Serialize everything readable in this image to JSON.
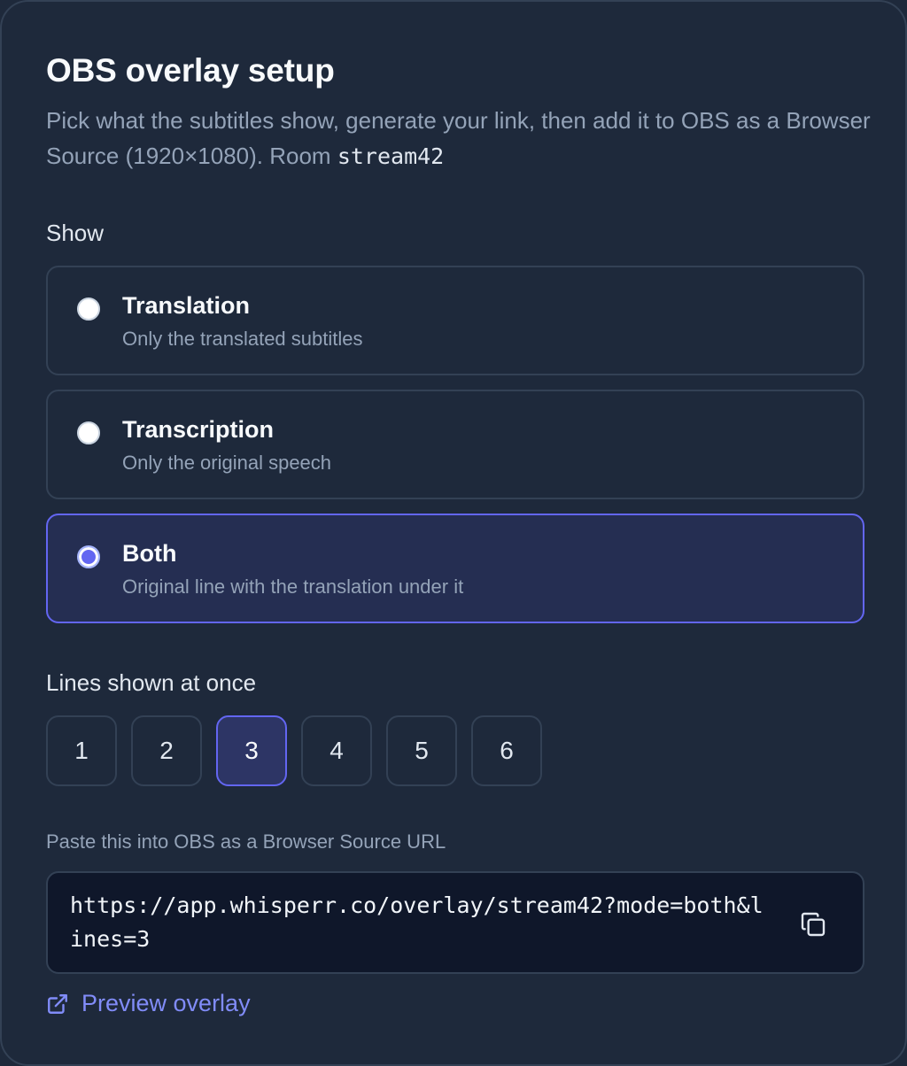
{
  "header": {
    "title": "OBS overlay setup",
    "description_prefix": "Pick what the subtitles show, generate your link, then add it to OBS as a Browser Source (1920×1080). Room ",
    "room_code": "stream42"
  },
  "show": {
    "label": "Show",
    "options": [
      {
        "title": "Translation",
        "subtitle": "Only the translated subtitles",
        "selected": false
      },
      {
        "title": "Transcription",
        "subtitle": "Only the original speech",
        "selected": false
      },
      {
        "title": "Both",
        "subtitle": "Original line with the translation under it",
        "selected": true
      }
    ]
  },
  "lines": {
    "label": "Lines shown at once",
    "options": [
      "1",
      "2",
      "3",
      "4",
      "5",
      "6"
    ],
    "selected": "3"
  },
  "url": {
    "label": "Paste this into OBS as a Browser Source URL",
    "value": "https://app.whisperr.co/overlay/stream42?mode=both&lines=3",
    "copy_icon": "copy-icon"
  },
  "preview": {
    "label": "Preview overlay",
    "icon": "external-link-icon"
  },
  "colors": {
    "background": "#1e293b",
    "accent": "#6366f1",
    "link": "#818cf8",
    "url_box": "#0f172a"
  }
}
